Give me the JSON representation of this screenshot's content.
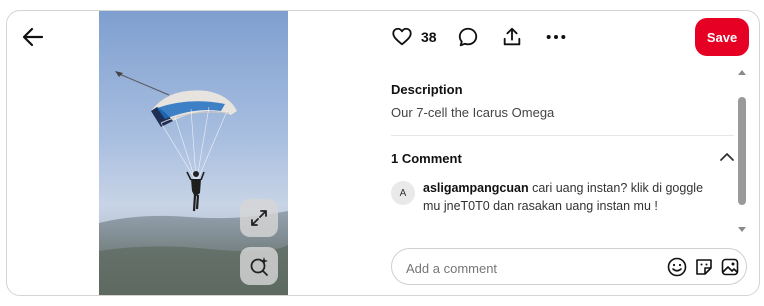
{
  "actions": {
    "like_count": "38",
    "save_label": "Save"
  },
  "description": {
    "heading": "Description",
    "text": "Our 7-cell the Icarus Omega"
  },
  "comments": {
    "heading": "1 Comment",
    "items": [
      {
        "avatar_initial": "A",
        "username": "asligampangcuan",
        "text": "cari uang instan? klik di goggle mu jneT0T0 dan rasakan uang instan mu !"
      }
    ]
  },
  "comment_box": {
    "placeholder": "Add a comment"
  },
  "colors": {
    "save_button": "#e60023",
    "sky_top": "#7f9fd0",
    "canopy_stripe": "#1f6fc0"
  },
  "icons": [
    "arrow-left-icon",
    "heart-icon",
    "comment-bubble-icon",
    "share-icon",
    "more-icon",
    "expand-icon",
    "visual-search-icon",
    "chevron-up-icon",
    "emoji-icon",
    "sticker-icon",
    "image-icon"
  ]
}
